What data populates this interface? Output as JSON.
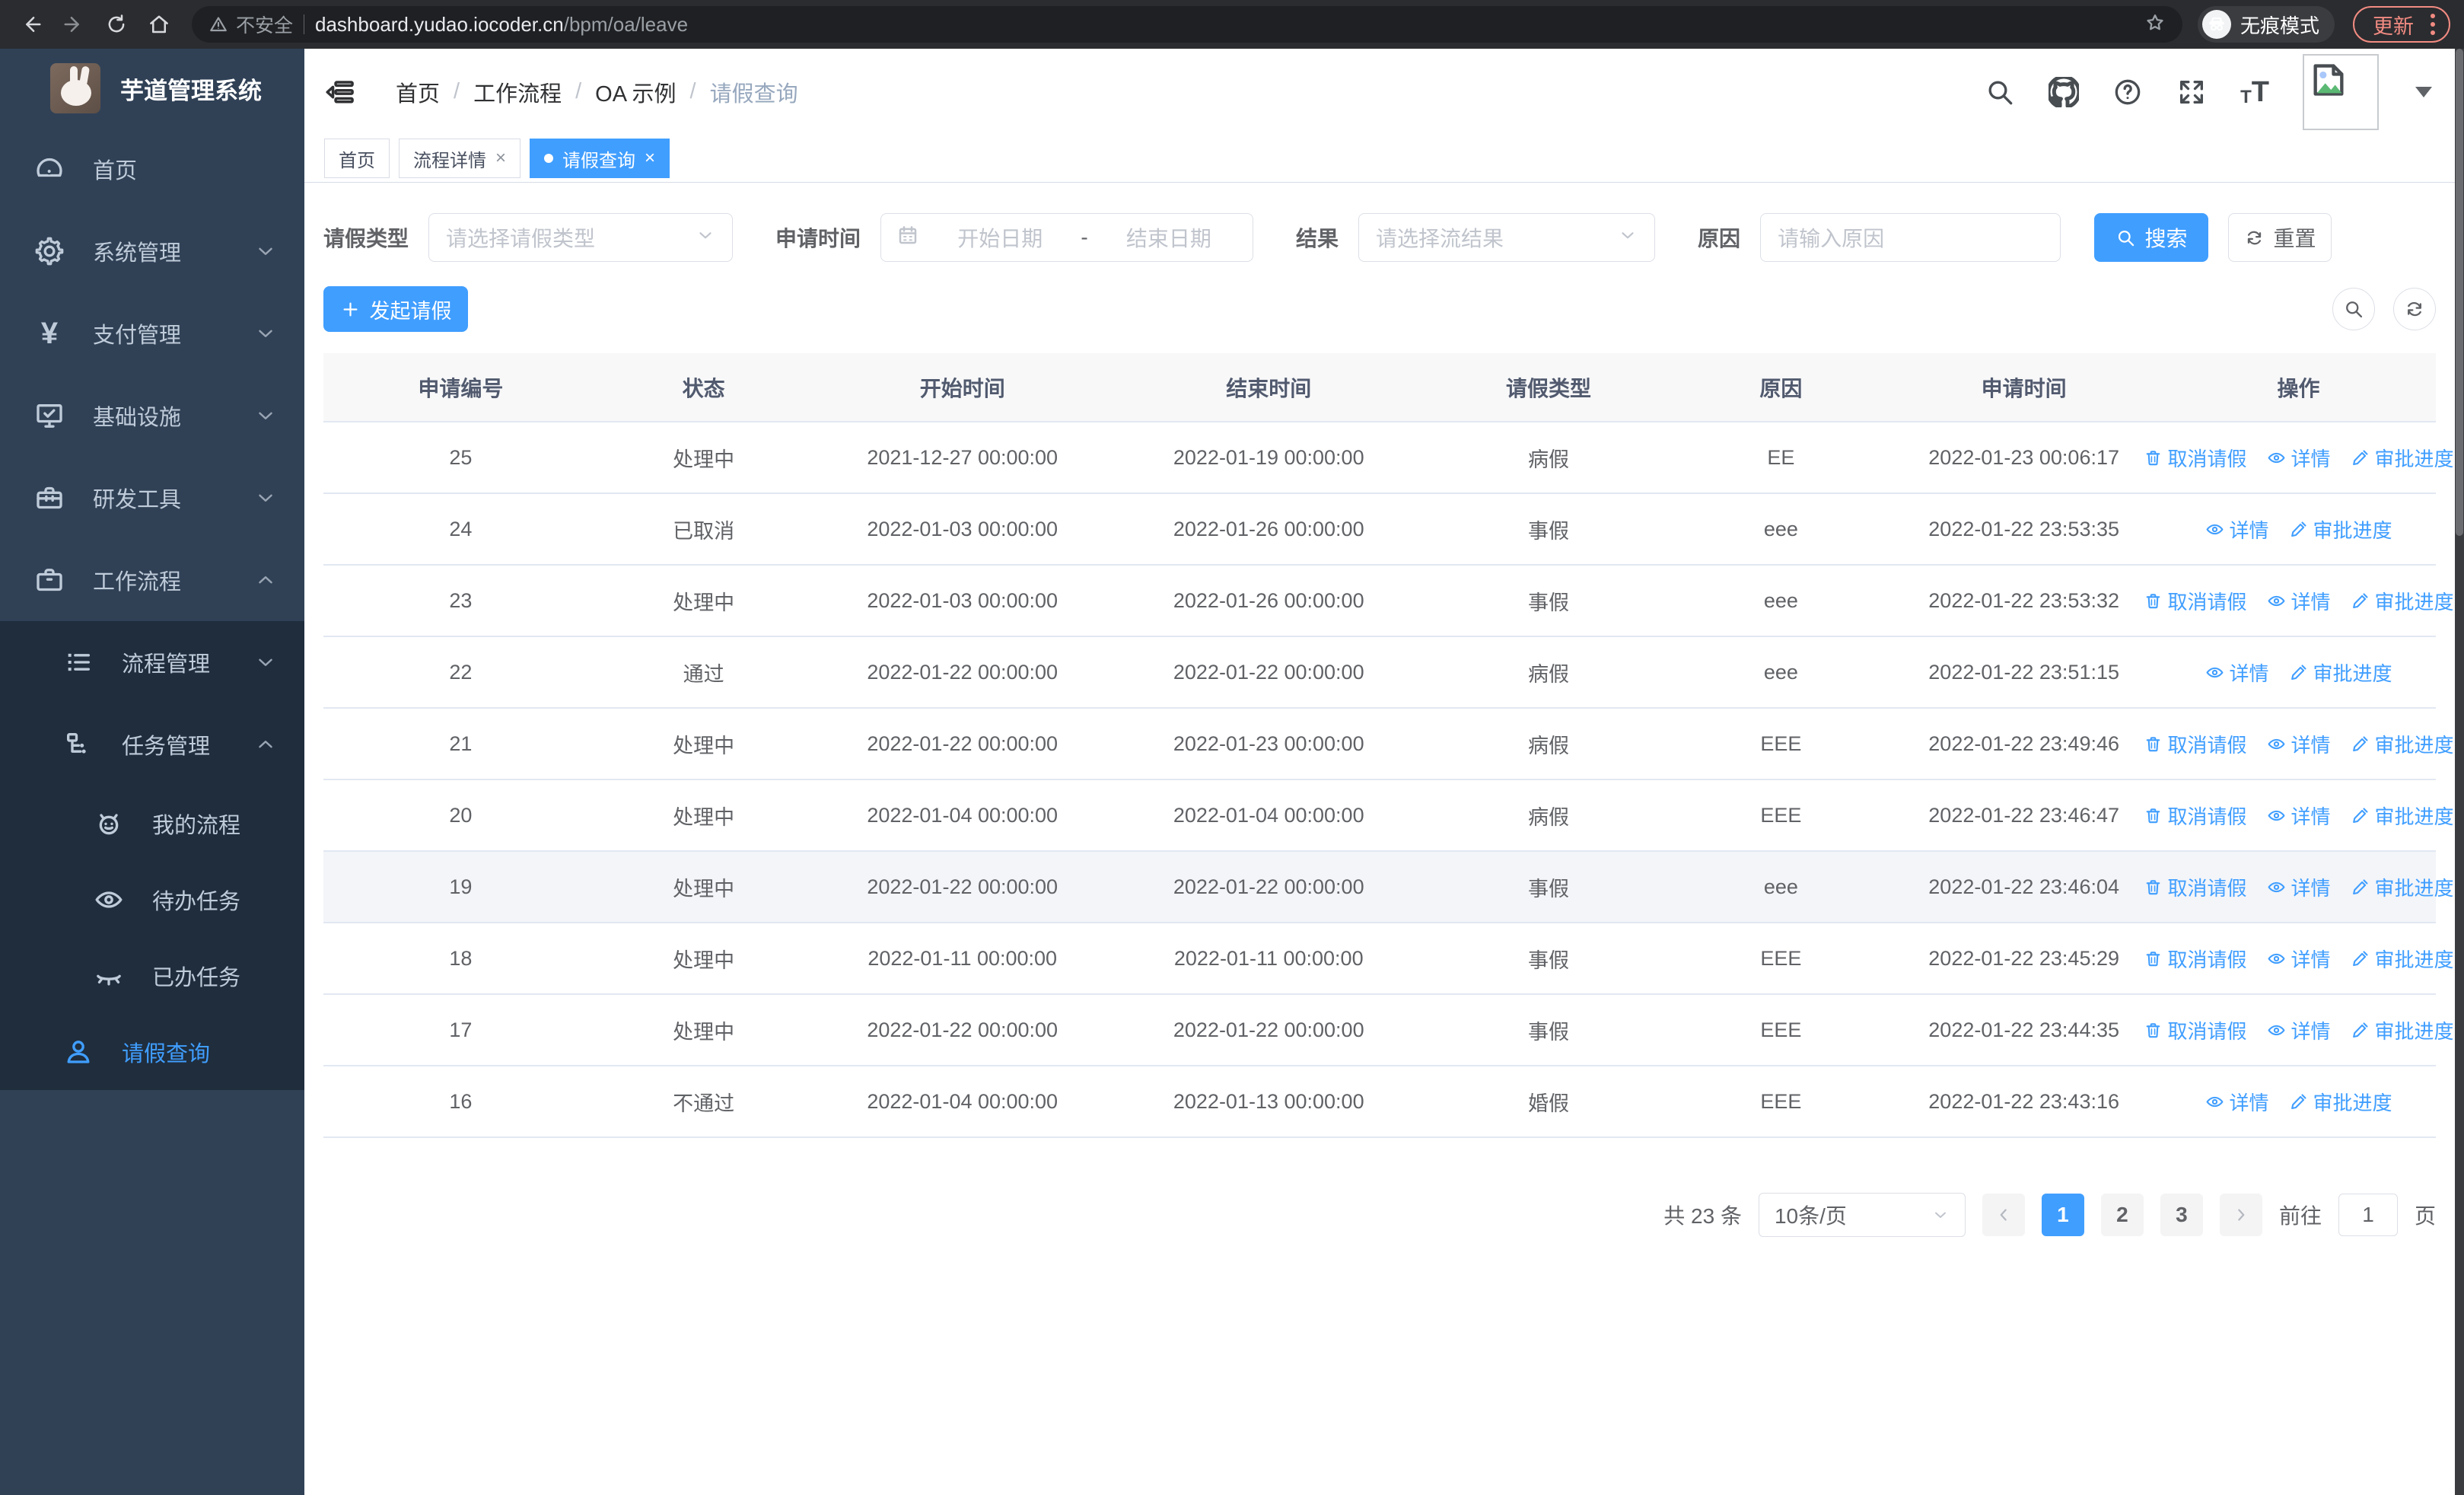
{
  "browser": {
    "security_label": "不安全",
    "url_host": "dashboard.yudao.iocoder.cn",
    "url_path": "/bpm/oa/leave",
    "incognito_label": "无痕模式",
    "update_label": "更新"
  },
  "sidebar": {
    "title": "芋道管理系统",
    "items": [
      {
        "name": "home",
        "label": "首页",
        "icon": "dashboard-icon",
        "level": 1,
        "chevron": null,
        "active": false,
        "dark": false
      },
      {
        "name": "system",
        "label": "系统管理",
        "icon": "gear-icon",
        "level": 1,
        "chevron": "down",
        "active": false,
        "dark": false
      },
      {
        "name": "payment",
        "label": "支付管理",
        "icon": "yen-icon",
        "level": 1,
        "chevron": "down",
        "active": false,
        "dark": false
      },
      {
        "name": "infrastructure",
        "label": "基础设施",
        "icon": "monitor-icon",
        "level": 1,
        "chevron": "down",
        "active": false,
        "dark": false
      },
      {
        "name": "dev-tools",
        "label": "研发工具",
        "icon": "toolbox-icon",
        "level": 1,
        "chevron": "down",
        "active": false,
        "dark": false
      },
      {
        "name": "workflow",
        "label": "工作流程",
        "icon": "briefcase-icon",
        "level": 1,
        "chevron": "up",
        "active": false,
        "dark": false
      },
      {
        "name": "process-mgmt",
        "label": "流程管理",
        "icon": "list-icon",
        "level": 2,
        "chevron": "down",
        "active": false,
        "dark": true
      },
      {
        "name": "task-mgmt",
        "label": "任务管理",
        "icon": "tree-icon",
        "level": 2,
        "chevron": "up",
        "active": false,
        "dark": true
      },
      {
        "name": "my-process",
        "label": "我的流程",
        "icon": "robot-icon",
        "level": 3,
        "chevron": null,
        "active": false,
        "dark": true
      },
      {
        "name": "todo-tasks",
        "label": "待办任务",
        "icon": "eye-open-icon",
        "level": 3,
        "chevron": null,
        "active": false,
        "dark": true
      },
      {
        "name": "done-tasks",
        "label": "已办任务",
        "icon": "eye-closed-icon",
        "level": 3,
        "chevron": null,
        "active": false,
        "dark": true
      },
      {
        "name": "leave-query",
        "label": "请假查询",
        "icon": "user-icon",
        "level": 2,
        "chevron": null,
        "active": true,
        "dark": true
      }
    ]
  },
  "breadcrumb": [
    "首页",
    "工作流程",
    "OA 示例",
    "请假查询"
  ],
  "tabs": [
    {
      "name": "home",
      "label": "首页",
      "closable": false,
      "active": false
    },
    {
      "name": "process-detail",
      "label": "流程详情",
      "closable": true,
      "active": false
    },
    {
      "name": "leave-query",
      "label": "请假查询",
      "closable": true,
      "active": true
    }
  ],
  "filters": {
    "leave_type_label": "请假类型",
    "leave_type_placeholder": "请选择请假类型",
    "apply_time_label": "申请时间",
    "start_placeholder": "开始日期",
    "range_separator": "-",
    "end_placeholder": "结束日期",
    "result_label": "结果",
    "result_placeholder": "请选择流结果",
    "reason_label": "原因",
    "reason_placeholder": "请输入原因",
    "search_label": "搜索",
    "reset_label": "重置"
  },
  "toolbar": {
    "create_label": "发起请假"
  },
  "table": {
    "headers": [
      "申请编号",
      "状态",
      "开始时间",
      "结束时间",
      "请假类型",
      "原因",
      "申请时间",
      "操作"
    ],
    "action_labels": {
      "cancel": "取消请假",
      "detail": "详情",
      "progress": "审批进度"
    },
    "rows": [
      {
        "id": "25",
        "status": "处理中",
        "start": "2021-12-27 00:00:00",
        "end": "2022-01-19 00:00:00",
        "type": "病假",
        "reason": "EE",
        "apply_time": "2022-01-23 00:06:17",
        "actions": [
          "cancel",
          "detail",
          "progress"
        ],
        "highlight": false
      },
      {
        "id": "24",
        "status": "已取消",
        "start": "2022-01-03 00:00:00",
        "end": "2022-01-26 00:00:00",
        "type": "事假",
        "reason": "eee",
        "apply_time": "2022-01-22 23:53:35",
        "actions": [
          "detail",
          "progress"
        ],
        "highlight": false
      },
      {
        "id": "23",
        "status": "处理中",
        "start": "2022-01-03 00:00:00",
        "end": "2022-01-26 00:00:00",
        "type": "事假",
        "reason": "eee",
        "apply_time": "2022-01-22 23:53:32",
        "actions": [
          "cancel",
          "detail",
          "progress"
        ],
        "highlight": false
      },
      {
        "id": "22",
        "status": "通过",
        "start": "2022-01-22 00:00:00",
        "end": "2022-01-22 00:00:00",
        "type": "病假",
        "reason": "eee",
        "apply_time": "2022-01-22 23:51:15",
        "actions": [
          "detail",
          "progress"
        ],
        "highlight": false
      },
      {
        "id": "21",
        "status": "处理中",
        "start": "2022-01-22 00:00:00",
        "end": "2022-01-23 00:00:00",
        "type": "病假",
        "reason": "EEE",
        "apply_time": "2022-01-22 23:49:46",
        "actions": [
          "cancel",
          "detail",
          "progress"
        ],
        "highlight": false
      },
      {
        "id": "20",
        "status": "处理中",
        "start": "2022-01-04 00:00:00",
        "end": "2022-01-04 00:00:00",
        "type": "病假",
        "reason": "EEE",
        "apply_time": "2022-01-22 23:46:47",
        "actions": [
          "cancel",
          "detail",
          "progress"
        ],
        "highlight": false
      },
      {
        "id": "19",
        "status": "处理中",
        "start": "2022-01-22 00:00:00",
        "end": "2022-01-22 00:00:00",
        "type": "事假",
        "reason": "eee",
        "apply_time": "2022-01-22 23:46:04",
        "actions": [
          "cancel",
          "detail",
          "progress"
        ],
        "highlight": true
      },
      {
        "id": "18",
        "status": "处理中",
        "start": "2022-01-11 00:00:00",
        "end": "2022-01-11 00:00:00",
        "type": "事假",
        "reason": "EEE",
        "apply_time": "2022-01-22 23:45:29",
        "actions": [
          "cancel",
          "detail",
          "progress"
        ],
        "highlight": false
      },
      {
        "id": "17",
        "status": "处理中",
        "start": "2022-01-22 00:00:00",
        "end": "2022-01-22 00:00:00",
        "type": "事假",
        "reason": "EEE",
        "apply_time": "2022-01-22 23:44:35",
        "actions": [
          "cancel",
          "detail",
          "progress"
        ],
        "highlight": false
      },
      {
        "id": "16",
        "status": "不通过",
        "start": "2022-01-04 00:00:00",
        "end": "2022-01-13 00:00:00",
        "type": "婚假",
        "reason": "EEE",
        "apply_time": "2022-01-22 23:43:16",
        "actions": [
          "detail",
          "progress"
        ],
        "highlight": false
      }
    ]
  },
  "pagination": {
    "total": "共 23 条",
    "page_size": "10条/页",
    "pages": [
      "1",
      "2",
      "3"
    ],
    "active_page": "1",
    "jump_prefix": "前往",
    "jump_value": "1",
    "jump_suffix": "页"
  },
  "colors": {
    "primary": "#409EFF",
    "sidebar_bg": "#304156",
    "submenu_bg": "#1F2D3D",
    "update_accent": "#F28B82"
  }
}
